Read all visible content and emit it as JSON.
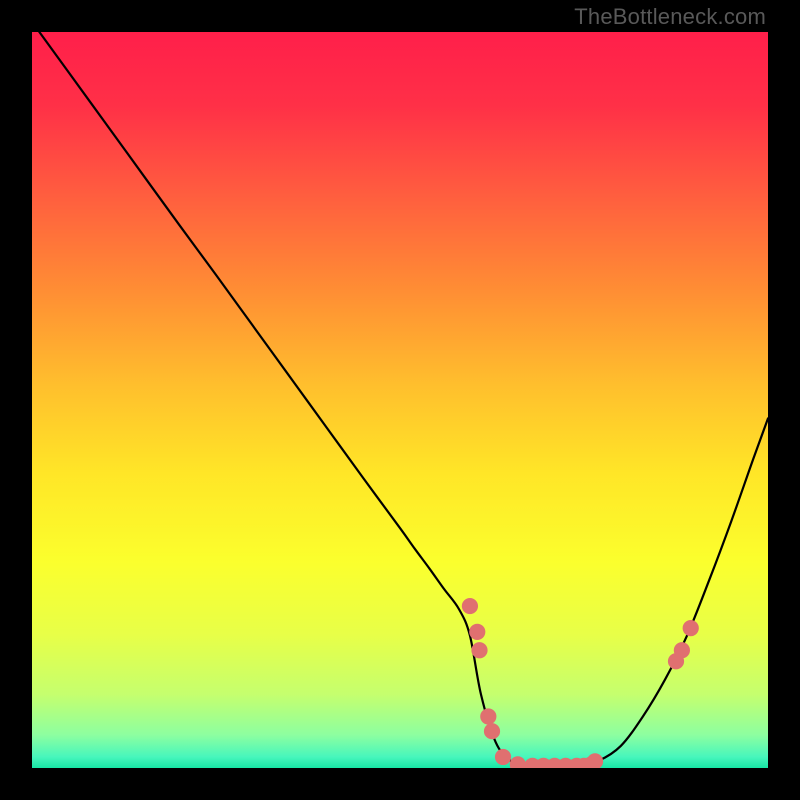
{
  "watermark": "TheBottleneck.com",
  "chart_data": {
    "type": "line",
    "title": "",
    "xlabel": "",
    "ylabel": "",
    "xlim": [
      0,
      100
    ],
    "ylim": [
      0,
      100
    ],
    "grid": false,
    "background_gradient_stops": [
      {
        "offset": 0.0,
        "color": "#ff1f4a"
      },
      {
        "offset": 0.1,
        "color": "#ff3047"
      },
      {
        "offset": 0.22,
        "color": "#ff5d3f"
      },
      {
        "offset": 0.35,
        "color": "#ff8d34"
      },
      {
        "offset": 0.48,
        "color": "#ffbf2d"
      },
      {
        "offset": 0.6,
        "color": "#ffe627"
      },
      {
        "offset": 0.72,
        "color": "#fbff2d"
      },
      {
        "offset": 0.82,
        "color": "#e7ff48"
      },
      {
        "offset": 0.9,
        "color": "#c5ff6e"
      },
      {
        "offset": 0.955,
        "color": "#8dffa0"
      },
      {
        "offset": 0.985,
        "color": "#47f6bc"
      },
      {
        "offset": 1.0,
        "color": "#18e6a5"
      }
    ],
    "series": [
      {
        "name": "bottleneck-curve",
        "color": "#000000",
        "x": [
          1,
          5,
          10,
          15,
          20,
          25,
          30,
          35,
          40,
          45,
          50,
          52,
          54,
          56,
          58,
          59.5,
          61,
          63,
          65,
          67,
          69,
          70.5,
          72,
          74,
          77,
          80,
          83,
          86,
          89,
          92,
          95,
          98,
          100
        ],
        "y": [
          100,
          94.5,
          87.6,
          80.7,
          73.8,
          67.0,
          60.1,
          53.2,
          46.3,
          39.4,
          32.6,
          29.8,
          27.1,
          24.3,
          21.6,
          18.0,
          10.0,
          3.5,
          1.0,
          0.3,
          0.3,
          0.3,
          0.3,
          0.3,
          1.0,
          3.0,
          7.0,
          12.0,
          18.0,
          25.5,
          33.5,
          42.0,
          47.5
        ]
      }
    ],
    "points": {
      "name": "highlighted-points",
      "color": "#e07070",
      "radius_pct": 1.1,
      "x": [
        59.5,
        60.5,
        60.8,
        62.0,
        62.5,
        64.0,
        66.0,
        68.0,
        69.5,
        71.0,
        72.5,
        74.0,
        75.0,
        76.0,
        76.5,
        87.5,
        88.3,
        89.5
      ],
      "y": [
        22.0,
        18.5,
        16.0,
        7.0,
        5.0,
        1.5,
        0.5,
        0.3,
        0.3,
        0.3,
        0.3,
        0.3,
        0.3,
        0.5,
        0.9,
        14.5,
        16.0,
        19.0
      ]
    }
  }
}
